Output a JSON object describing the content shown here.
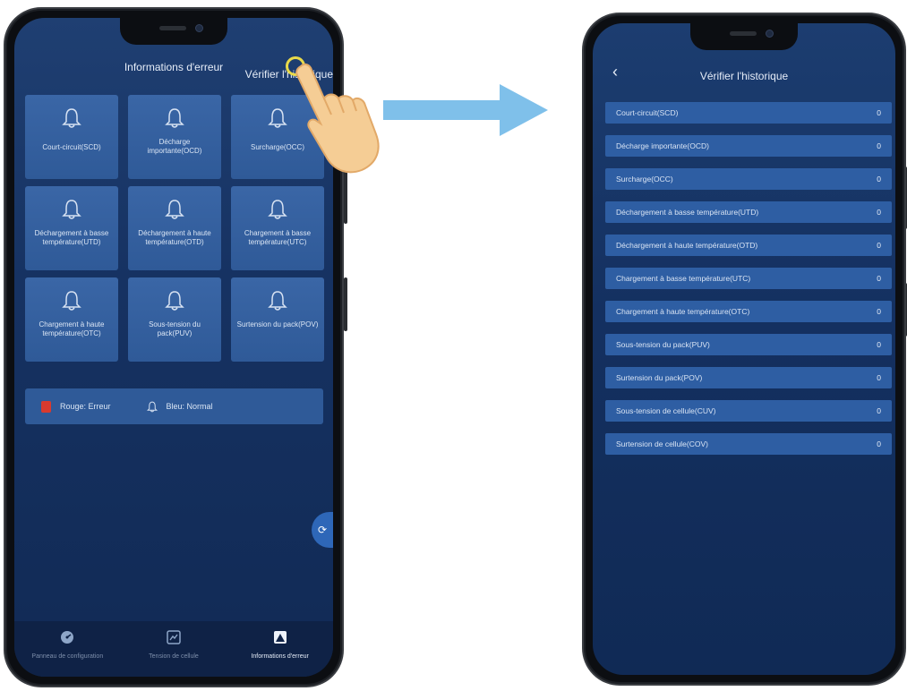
{
  "left_screen": {
    "title": "Informations d'erreur",
    "history_link": "Vérifier l'historique",
    "tiles": [
      {
        "label": "Court-circuit(SCD)"
      },
      {
        "label": "Décharge importante(OCD)"
      },
      {
        "label": "Surcharge(OCC)"
      },
      {
        "label": "Déchargement à basse température(UTD)"
      },
      {
        "label": "Déchargement à haute température(OTD)"
      },
      {
        "label": "Chargement à basse température(UTC)"
      },
      {
        "label": "Chargement à haute température(OTC)"
      },
      {
        "label": "Sous-tension du pack(PUV)"
      },
      {
        "label": "Surtension du pack(POV)"
      }
    ],
    "legend": {
      "error_label": "Rouge: Erreur",
      "normal_label": "Bleu: Normal",
      "error_color": "#d93a2e",
      "normal_color": "#2f5a98"
    },
    "bottom_nav": [
      {
        "label": "Panneau de configuration",
        "icon": "dashboard-icon",
        "active": false
      },
      {
        "label": "Tension de cellule",
        "icon": "chart-icon",
        "active": false
      },
      {
        "label": "Informations d'erreur",
        "icon": "error-info-icon",
        "active": true
      }
    ]
  },
  "right_screen": {
    "title": "Vérifier l'historique",
    "history": [
      {
        "label": "Court-circuit(SCD)",
        "count": "0"
      },
      {
        "label": "Décharge importante(OCD)",
        "count": "0"
      },
      {
        "label": "Surcharge(OCC)",
        "count": "0"
      },
      {
        "label": "Déchargement à basse température(UTD)",
        "count": "0"
      },
      {
        "label": "Déchargement à haute température(OTD)",
        "count": "0"
      },
      {
        "label": "Chargement à basse température(UTC)",
        "count": "0"
      },
      {
        "label": "Chargement à haute température(OTC)",
        "count": "0"
      },
      {
        "label": "Sous-tension du pack(PUV)",
        "count": "0"
      },
      {
        "label": "Surtension du pack(POV)",
        "count": "0"
      },
      {
        "label": "Sous-tension de cellule(CUV)",
        "count": "0"
      },
      {
        "label": "Surtension de cellule(COV)",
        "count": "0"
      }
    ]
  },
  "colors": {
    "screen_background": "#163262",
    "tile": "#2f5a98",
    "arrow": "#7fc0ea",
    "tap_highlight": "#e8d94a"
  }
}
